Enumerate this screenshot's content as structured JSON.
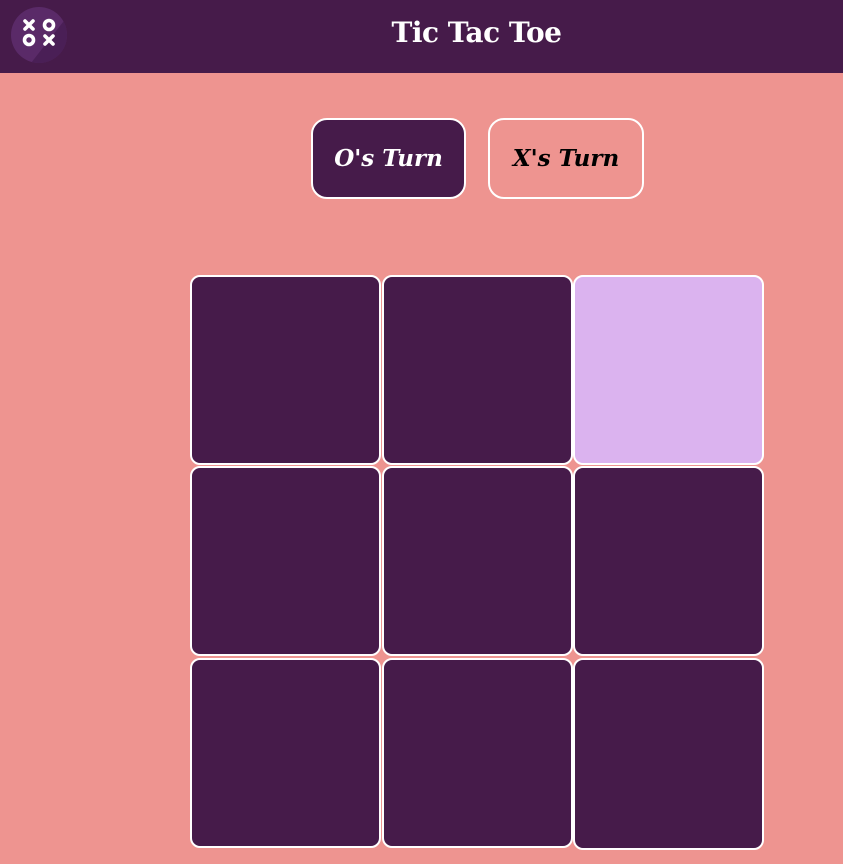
{
  "header": {
    "title": "Tic Tac Toe",
    "logo_icon": "xo-logo-icon"
  },
  "turns": {
    "o_label": "O's Turn",
    "x_label": "X's Turn",
    "active": "O"
  },
  "board": {
    "cells": [
      "",
      "",
      "",
      "",
      "",
      "",
      "",
      "",
      ""
    ],
    "highlighted_cell": 2
  },
  "colors": {
    "background": "#ee9490",
    "header": "#461b4a",
    "cell": "#461b4a",
    "cell_highlight": "#dbb3ef",
    "border": "#ffffff"
  }
}
